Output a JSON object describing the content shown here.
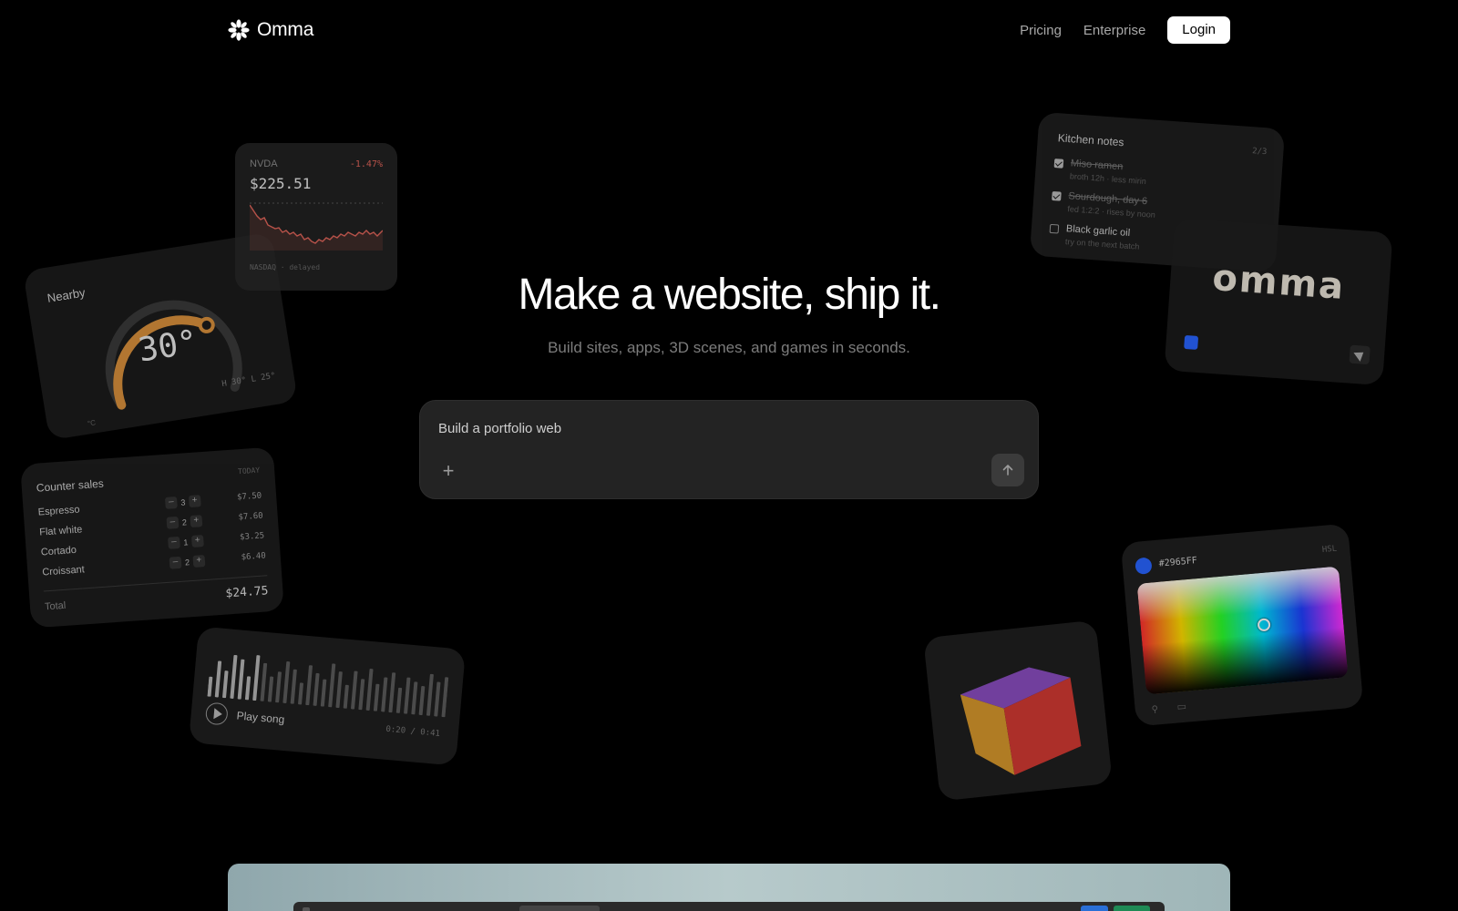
{
  "header": {
    "brand_name": "Omma",
    "links": [
      "Pricing",
      "Enterprise"
    ],
    "login_label": "Login"
  },
  "hero": {
    "title": "Make a website, ship it.",
    "subtitle": "Build sites, apps, 3D scenes, and games in seconds."
  },
  "prompt": {
    "value": "Build a portfolio web",
    "add_icon": "plus-icon",
    "send_icon": "arrow-up-icon"
  },
  "weather": {
    "title": "Nearby",
    "temperature": "30°",
    "high_low": "H 30° L 25°",
    "unit": "°C",
    "accent": "#d9913c"
  },
  "stock": {
    "symbol": "NVDA",
    "change": "-1.47%",
    "price": "$225.51",
    "footer": "NASDAQ · delayed",
    "color": "#e0645a"
  },
  "sales": {
    "title": "Counter sales",
    "period": "TODAY",
    "items": [
      {
        "name": "Espresso",
        "qty": "3",
        "amount": "$7.50"
      },
      {
        "name": "Flat white",
        "qty": "2",
        "amount": "$7.60"
      },
      {
        "name": "Cortado",
        "qty": "1",
        "amount": "$3.25"
      },
      {
        "name": "Croissant",
        "qty": "2",
        "amount": "$6.40"
      }
    ],
    "total_label": "Total",
    "total_value": "$24.75"
  },
  "audio": {
    "label": "Play song",
    "time": "0:20 / 0:41",
    "progress": 0.49
  },
  "notes": {
    "title": "Kitchen notes",
    "page": "2/3",
    "items": [
      {
        "text": "Miso ramen",
        "sub": "broth 12h · less mirin",
        "done": true
      },
      {
        "text": "Sourdough, day 6",
        "sub": "fed 1:2:2 · rises by noon",
        "done": true
      },
      {
        "text": "Black garlic oil",
        "sub": "try on the next batch",
        "done": false
      }
    ]
  },
  "logo_card": {
    "word": "omma",
    "swatch": "#2965ff"
  },
  "picker": {
    "hex": "#2965FF",
    "mode": "HSL",
    "color": "#2965ff"
  },
  "cube": {
    "colors": {
      "top": "#8a4ec0",
      "left": "#d7982c",
      "right": "#d23a32"
    }
  }
}
